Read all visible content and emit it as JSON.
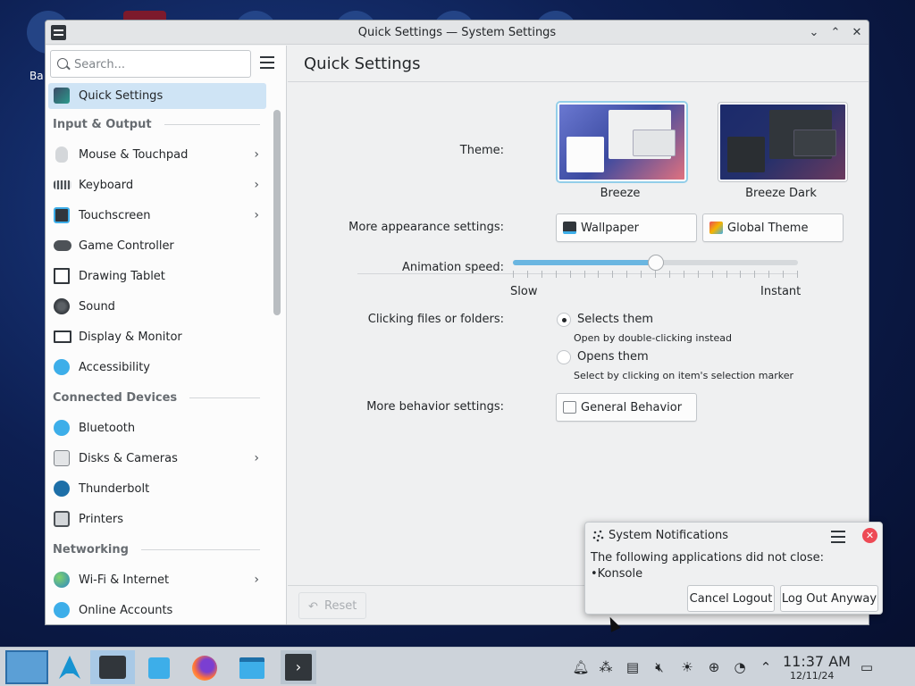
{
  "desktop": {
    "partial_label": "Ba"
  },
  "window": {
    "title": "Quick Settings — System Settings",
    "minimize_glyph": "⌄",
    "maximize_glyph": "⌃",
    "close_glyph": "✕"
  },
  "sidebar": {
    "search_placeholder": "Search...",
    "selected_item": "Quick Settings",
    "sections": [
      {
        "title": "Input & Output",
        "items": [
          {
            "label": "Mouse & Touchpad",
            "icon": "mouse-icon",
            "has_children": true
          },
          {
            "label": "Keyboard",
            "icon": "keyboard-icon",
            "has_children": true
          },
          {
            "label": "Touchscreen",
            "icon": "touchscreen-icon",
            "has_children": true
          },
          {
            "label": "Game Controller",
            "icon": "gamepad-icon",
            "has_children": false
          },
          {
            "label": "Drawing Tablet",
            "icon": "tablet-icon",
            "has_children": false
          },
          {
            "label": "Sound",
            "icon": "speaker-icon",
            "has_children": false
          },
          {
            "label": "Display & Monitor",
            "icon": "monitor-icon",
            "has_children": false
          },
          {
            "label": "Accessibility",
            "icon": "accessibility-icon",
            "has_children": false
          }
        ]
      },
      {
        "title": "Connected Devices",
        "items": [
          {
            "label": "Bluetooth",
            "icon": "bluetooth-icon",
            "has_children": false
          },
          {
            "label": "Disks & Cameras",
            "icon": "disk-icon",
            "has_children": true
          },
          {
            "label": "Thunderbolt",
            "icon": "thunderbolt-icon",
            "has_children": false
          },
          {
            "label": "Printers",
            "icon": "printer-icon",
            "has_children": false
          }
        ]
      },
      {
        "title": "Networking",
        "items": [
          {
            "label": "Wi-Fi & Internet",
            "icon": "globe-icon",
            "has_children": true
          },
          {
            "label": "Online Accounts",
            "icon": "accounts-icon",
            "has_children": false
          }
        ]
      }
    ]
  },
  "main": {
    "title": "Quick Settings",
    "theme_label": "Theme:",
    "themes": [
      {
        "name": "Breeze",
        "selected": true
      },
      {
        "name": "Breeze Dark",
        "selected": false
      }
    ],
    "more_appearance_label": "More appearance settings:",
    "wallpaper_button": "Wallpaper",
    "global_theme_button": "Global Theme",
    "animation_label": "Animation speed:",
    "animation_value_fraction": 0.5,
    "animation_min_label": "Slow",
    "animation_max_label": "Instant",
    "clicking_label": "Clicking files or folders:",
    "click_options": [
      {
        "label": "Selects them",
        "hint": "Open by double-clicking instead",
        "checked": true
      },
      {
        "label": "Opens them",
        "hint": "Select by clicking on item's selection marker",
        "checked": false
      }
    ],
    "more_behavior_label": "More behavior settings:",
    "general_behavior_button": "General Behavior",
    "reset_button": "Reset"
  },
  "notification": {
    "app": "System Notifications",
    "body": "The following applications did not close:\n•Konsole",
    "cancel_button": "Cancel Logout",
    "confirm_button": "Log Out Anyway"
  },
  "taskbar": {
    "clock_time": "11:37 AM",
    "clock_date": "12/11/24",
    "tray_icons": [
      "bell-icon",
      "share-icon",
      "clipboard-icon",
      "volume-muted-icon",
      "brightness-icon",
      "network-icon",
      "update-icon",
      "chevron-up-icon"
    ]
  },
  "colors": {
    "accent": "#3daee9",
    "selection": "#cfe4f5",
    "close_red": "#ed4a55"
  }
}
